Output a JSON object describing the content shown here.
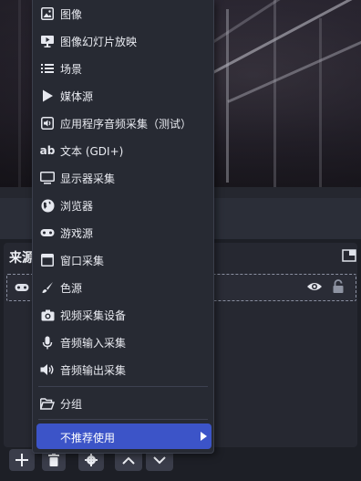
{
  "sources_dock": {
    "title": "来源"
  },
  "menu": {
    "items": [
      {
        "label": "图像",
        "icon": "image-icon"
      },
      {
        "label": "图像幻灯片放映",
        "icon": "slideshow-icon"
      },
      {
        "label": "场景",
        "icon": "scene-list-icon"
      },
      {
        "label": "媒体源",
        "icon": "play-icon"
      },
      {
        "label": "应用程序音频采集（测试）",
        "icon": "app-audio-icon"
      },
      {
        "label": "文本 (GDI+)",
        "icon": "text-icon"
      },
      {
        "label": "显示器采集",
        "icon": "monitor-icon"
      },
      {
        "label": "浏览器",
        "icon": "globe-icon"
      },
      {
        "label": "游戏源",
        "icon": "gamepad-icon"
      },
      {
        "label": "窗口采集",
        "icon": "window-icon"
      },
      {
        "label": "色源",
        "icon": "brush-icon"
      },
      {
        "label": "视频采集设备",
        "icon": "camera-icon"
      },
      {
        "label": "音频输入采集",
        "icon": "microphone-icon"
      },
      {
        "label": "音频输出采集",
        "icon": "speaker-icon"
      }
    ],
    "group_label": "分组",
    "deprecated_label": "不推荐使用"
  },
  "colors": {
    "menu_bg": "#272a33",
    "highlight": "#3c54c8",
    "dock_bg": "#262831"
  }
}
